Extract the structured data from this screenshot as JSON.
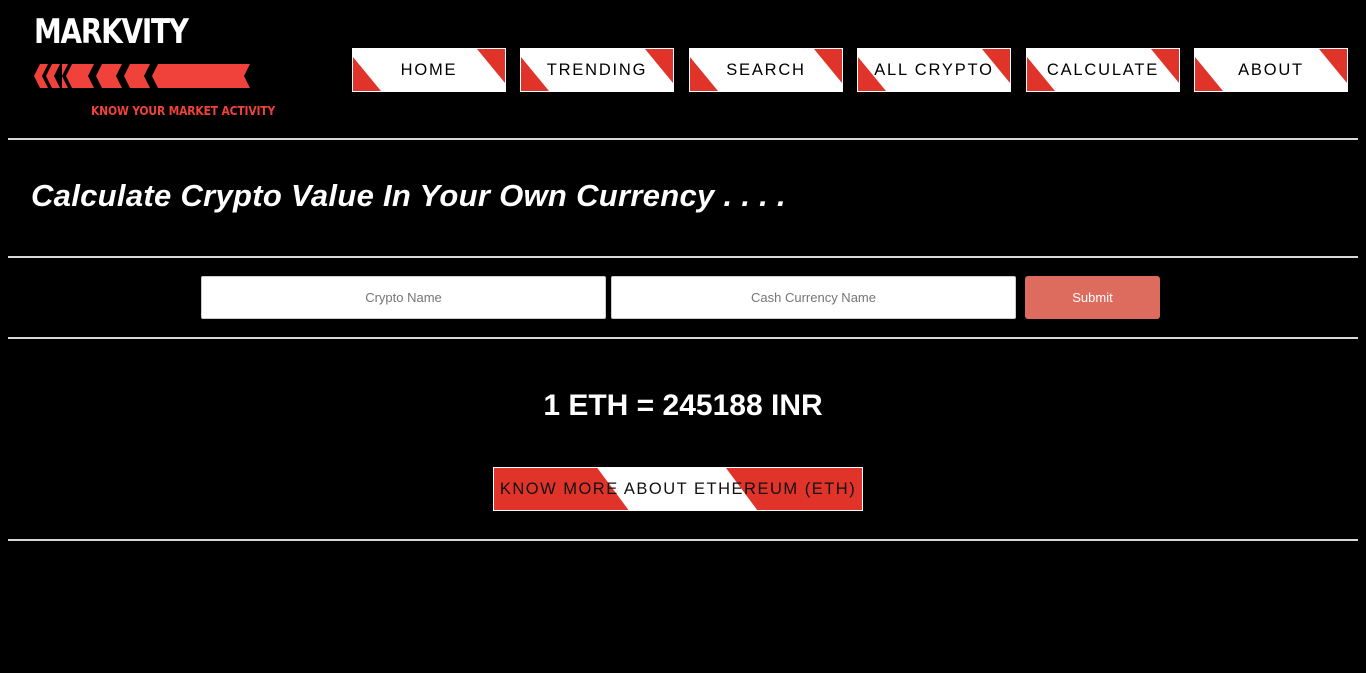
{
  "brand": {
    "title": "MARKVITY",
    "tagline": "KNOW YOUR MARKET ACTIVITY",
    "accent_color": "#e0342b",
    "arrow_icon": "chevron-left-arrows"
  },
  "nav": [
    {
      "label": "HOME"
    },
    {
      "label": "TRENDING"
    },
    {
      "label": "SEARCH"
    },
    {
      "label": "ALL CRYPTO"
    },
    {
      "label": "CALCULATE"
    },
    {
      "label": "ABOUT"
    }
  ],
  "main": {
    "heading": "Calculate Crypto Value In Your Own Currency . . . .",
    "form": {
      "crypto_placeholder": "Crypto Name",
      "crypto_value": "",
      "currency_placeholder": "Cash Currency Name",
      "currency_value": "",
      "submit_label": "Submit",
      "submit_color": "#dd6b5e"
    },
    "result": "1 ETH = 245188 INR",
    "more_button": "KNOW MORE ABOUT ETHEREUM (ETH)"
  }
}
